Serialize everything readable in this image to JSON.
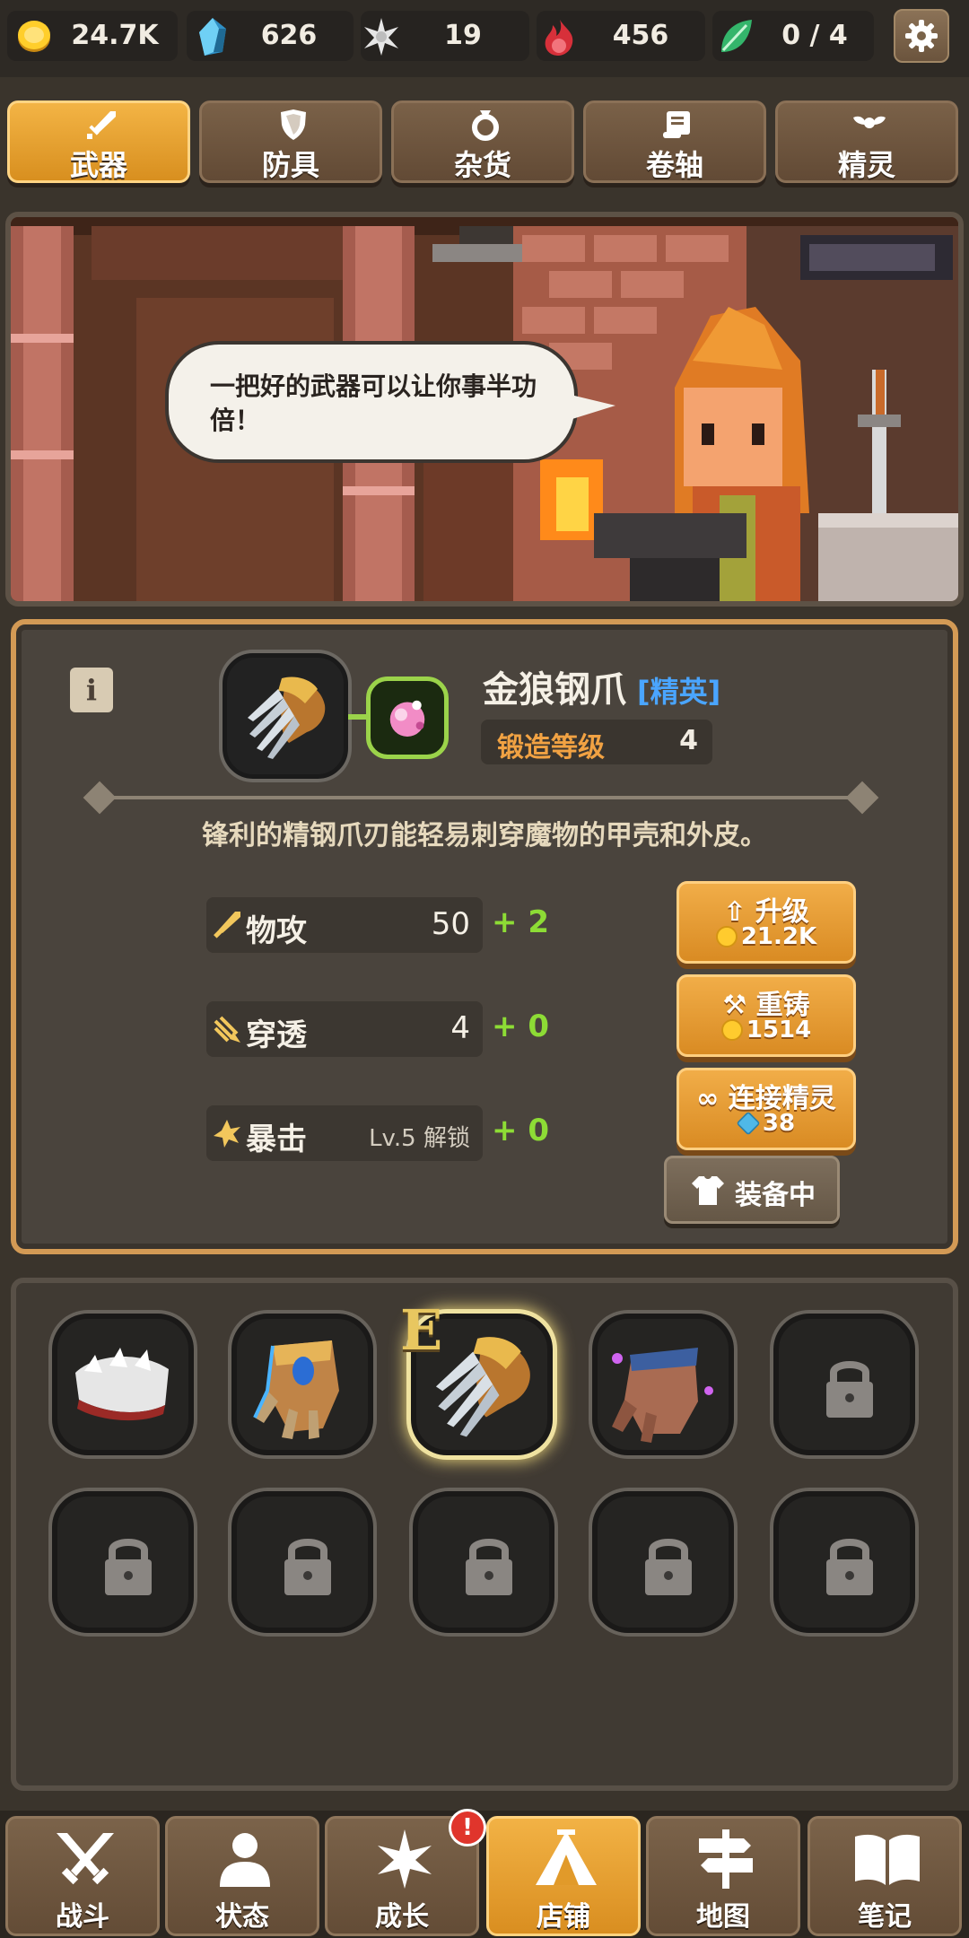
{
  "resources": [
    {
      "icon": "gold-coin-icon",
      "value": "24.7K"
    },
    {
      "icon": "blue-gem-icon",
      "value": "626"
    },
    {
      "icon": "white-star-shard-icon",
      "value": "19"
    },
    {
      "icon": "red-flame-icon",
      "value": "456"
    },
    {
      "icon": "green-leaf-icon",
      "value": "0 / 4"
    }
  ],
  "tabs": [
    {
      "label": "武器",
      "icon": "sword-icon",
      "active": true
    },
    {
      "label": "防具",
      "icon": "shield-icon",
      "active": false
    },
    {
      "label": "杂货",
      "icon": "ring-icon",
      "active": false
    },
    {
      "label": "卷轴",
      "icon": "scroll-icon",
      "active": false
    },
    {
      "label": "精灵",
      "icon": "spirit-wings-icon",
      "active": false
    }
  ],
  "scene": {
    "speech": "一把好的武器可以让你事半功倍！"
  },
  "item": {
    "name": "金狼钢爪",
    "rarity": "[精英]",
    "forge_label": "锻造等级",
    "forge_level": "4",
    "description": "锋利的精钢爪刃能轻易刺穿魔物的甲壳和外皮。",
    "grade": "E"
  },
  "stats": [
    {
      "icon": "sword-attack-icon",
      "label": "物攻",
      "value": "50",
      "bonus": "+ 2"
    },
    {
      "icon": "pierce-icon",
      "label": "穿透",
      "value": "4",
      "bonus": "+ 0"
    },
    {
      "icon": "critical-burst-icon",
      "label": "暴击",
      "value": "Lv.5 解锁",
      "bonus": "+ 0"
    }
  ],
  "actions": {
    "upgrade": {
      "label": "升级",
      "cost": "21.2K"
    },
    "reforge": {
      "label": "重铸",
      "cost": "1514"
    },
    "link": {
      "label": "连接精灵",
      "cost": "38"
    },
    "equipped": {
      "label": "装备中"
    }
  },
  "inventory": [
    {
      "name": "silver-spiked-gauntlet",
      "locked": false
    },
    {
      "name": "blue-gem-gauntlet",
      "locked": false
    },
    {
      "name": "golden-wolf-claw",
      "locked": false,
      "selected": true
    },
    {
      "name": "mage-glove",
      "locked": false
    },
    {
      "name": "locked-item-5",
      "locked": true
    },
    {
      "name": "locked-item-6",
      "locked": true
    },
    {
      "name": "locked-item-7",
      "locked": true
    },
    {
      "name": "locked-item-8",
      "locked": true
    },
    {
      "name": "locked-item-9",
      "locked": true
    },
    {
      "name": "locked-item-10",
      "locked": true
    }
  ],
  "nav": [
    {
      "label": "战斗",
      "icon": "crossed-swords-icon",
      "active": false
    },
    {
      "label": "状态",
      "icon": "person-icon",
      "active": false
    },
    {
      "label": "成长",
      "icon": "sparkle-icon",
      "active": false,
      "badge": "!"
    },
    {
      "label": "店铺",
      "icon": "tent-shop-icon",
      "active": true
    },
    {
      "label": "地图",
      "icon": "signpost-icon",
      "active": false
    },
    {
      "label": "笔记",
      "icon": "open-book-icon",
      "active": false
    }
  ],
  "colors": {
    "accent": "#e8a033",
    "rarity": "#4aa5ff",
    "bonus": "#8ddc35",
    "forge": "#f1a243"
  }
}
